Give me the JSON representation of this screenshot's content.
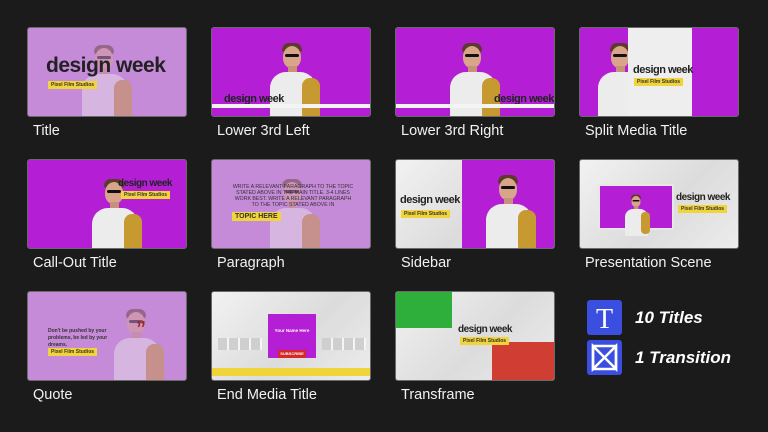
{
  "cards": [
    {
      "label": "Title"
    },
    {
      "label": "Lower 3rd Left"
    },
    {
      "label": "Lower 3rd Right"
    },
    {
      "label": "Split Media Title"
    },
    {
      "label": "Call-Out Title"
    },
    {
      "label": "Paragraph"
    },
    {
      "label": "Sidebar"
    },
    {
      "label": "Presentation Scene"
    },
    {
      "label": "Quote"
    },
    {
      "label": "End Media Title"
    },
    {
      "label": "Transframe"
    }
  ],
  "thumb_text": {
    "design_week": "design week",
    "studio": "Pixel Film Studios",
    "paragraph_body": "WRITE A RELEVANT PARAGRAPH TO THE TOPIC STATED ABOVE IN THE MAIN TITLE. 3-4 LINES WORK BEST. WRITE A RELEVANT PARAGRAPH TO THE TOPIC STATED ABOVE IN",
    "topic_here": "TOPIC HERE",
    "quote": "Don't be pushed by your problems, be led by your dreams.",
    "end_media_name": "Your Name Here",
    "subscribe": "SUBSCRIBE"
  },
  "legend": [
    {
      "count_text": "10 Titles",
      "icon": "title-T-icon"
    },
    {
      "count_text": "1 Transition",
      "icon": "transition-bowtie-icon"
    }
  ],
  "colors": {
    "magenta": "#b41fd6",
    "accent_yellow": "#f1d33a",
    "legend_blue": "#3a4fe0",
    "background": "#1b1b1b"
  }
}
